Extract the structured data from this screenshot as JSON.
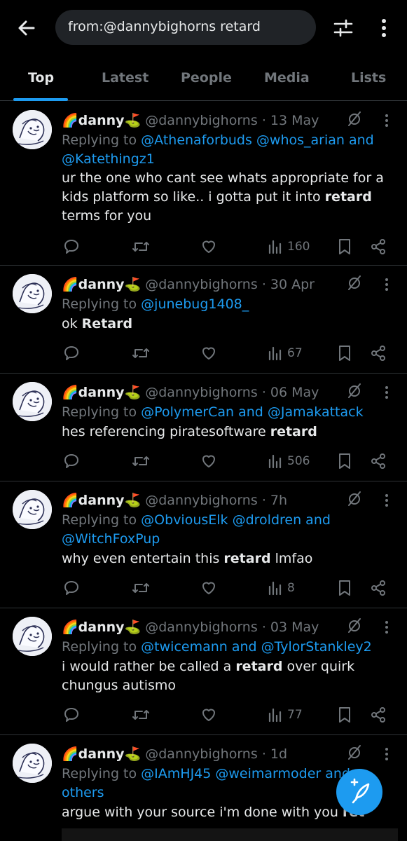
{
  "search": {
    "query": "from:@dannybighorns retard"
  },
  "tabs": [
    {
      "label": "Top"
    },
    {
      "label": "Latest"
    },
    {
      "label": "People"
    },
    {
      "label": "Media"
    },
    {
      "label": "Lists"
    }
  ],
  "colors": {
    "accent": "#1d9bf0",
    "background": "#000000",
    "muted": "#71767b",
    "text": "#e7e9ea"
  },
  "icons": [
    "back-arrow-icon",
    "filter-icon",
    "more-vertical-icon",
    "mute-icon",
    "reply-icon",
    "retweet-icon",
    "like-icon",
    "views-icon",
    "bookmark-icon",
    "share-icon",
    "compose-icon"
  ],
  "tweets": [
    {
      "name": "🌈danny⛳",
      "handle": "@dannybighorns",
      "date": "· 13 May",
      "replying_to": "Replying to",
      "mentions": "@Athenaforbuds @whos_arian and @Katethingz1",
      "text_before": "ur the one who cant see whats appropriate for a kids platform so like.. i gotta put it into ",
      "bold": "retard",
      "text_after": " terms for you",
      "views": "160"
    },
    {
      "name": "🌈danny⛳",
      "handle": "@dannybighorns",
      "date": "· 30 Apr",
      "replying_to": "Replying to",
      "mentions": "@junebug1408_",
      "text_before": "ok ",
      "bold": "Retard",
      "text_after": "",
      "views": "67"
    },
    {
      "name": "🌈danny⛳",
      "handle": "@dannybighorns",
      "date": "· 06 May",
      "replying_to": "Replying to",
      "mentions": "@PolymerCan and @Jamakattack",
      "text_before": "hes referencing piratesoftware ",
      "bold": "retard",
      "text_after": "",
      "views": "506"
    },
    {
      "name": "🌈danny⛳",
      "handle": "@dannybighorns",
      "date": "· 7h",
      "replying_to": "Replying to",
      "mentions": "@ObviousElk @droldren and @WitchFoxPup",
      "text_before": "why even entertain this ",
      "bold": "retard",
      "text_after": " lmfao",
      "views": "8"
    },
    {
      "name": "🌈danny⛳",
      "handle": "@dannybighorns",
      "date": "· 03 May",
      "replying_to": "Replying to",
      "mentions": "@twicemann and @TylorStankley2",
      "text_before": "i would rather be called a ",
      "bold": "retard",
      "text_after": " over quirk chungus autismo",
      "views": "77"
    },
    {
      "name": "🌈danny⛳",
      "handle": "@dannybighorns",
      "date": "· 1d",
      "replying_to": "Replying to",
      "mentions": "@IAmHJ45 @weimarmoder and others",
      "text_before": "argue with your source i'm done with you ",
      "bold": "ret",
      "text_after": "",
      "views": ""
    }
  ]
}
